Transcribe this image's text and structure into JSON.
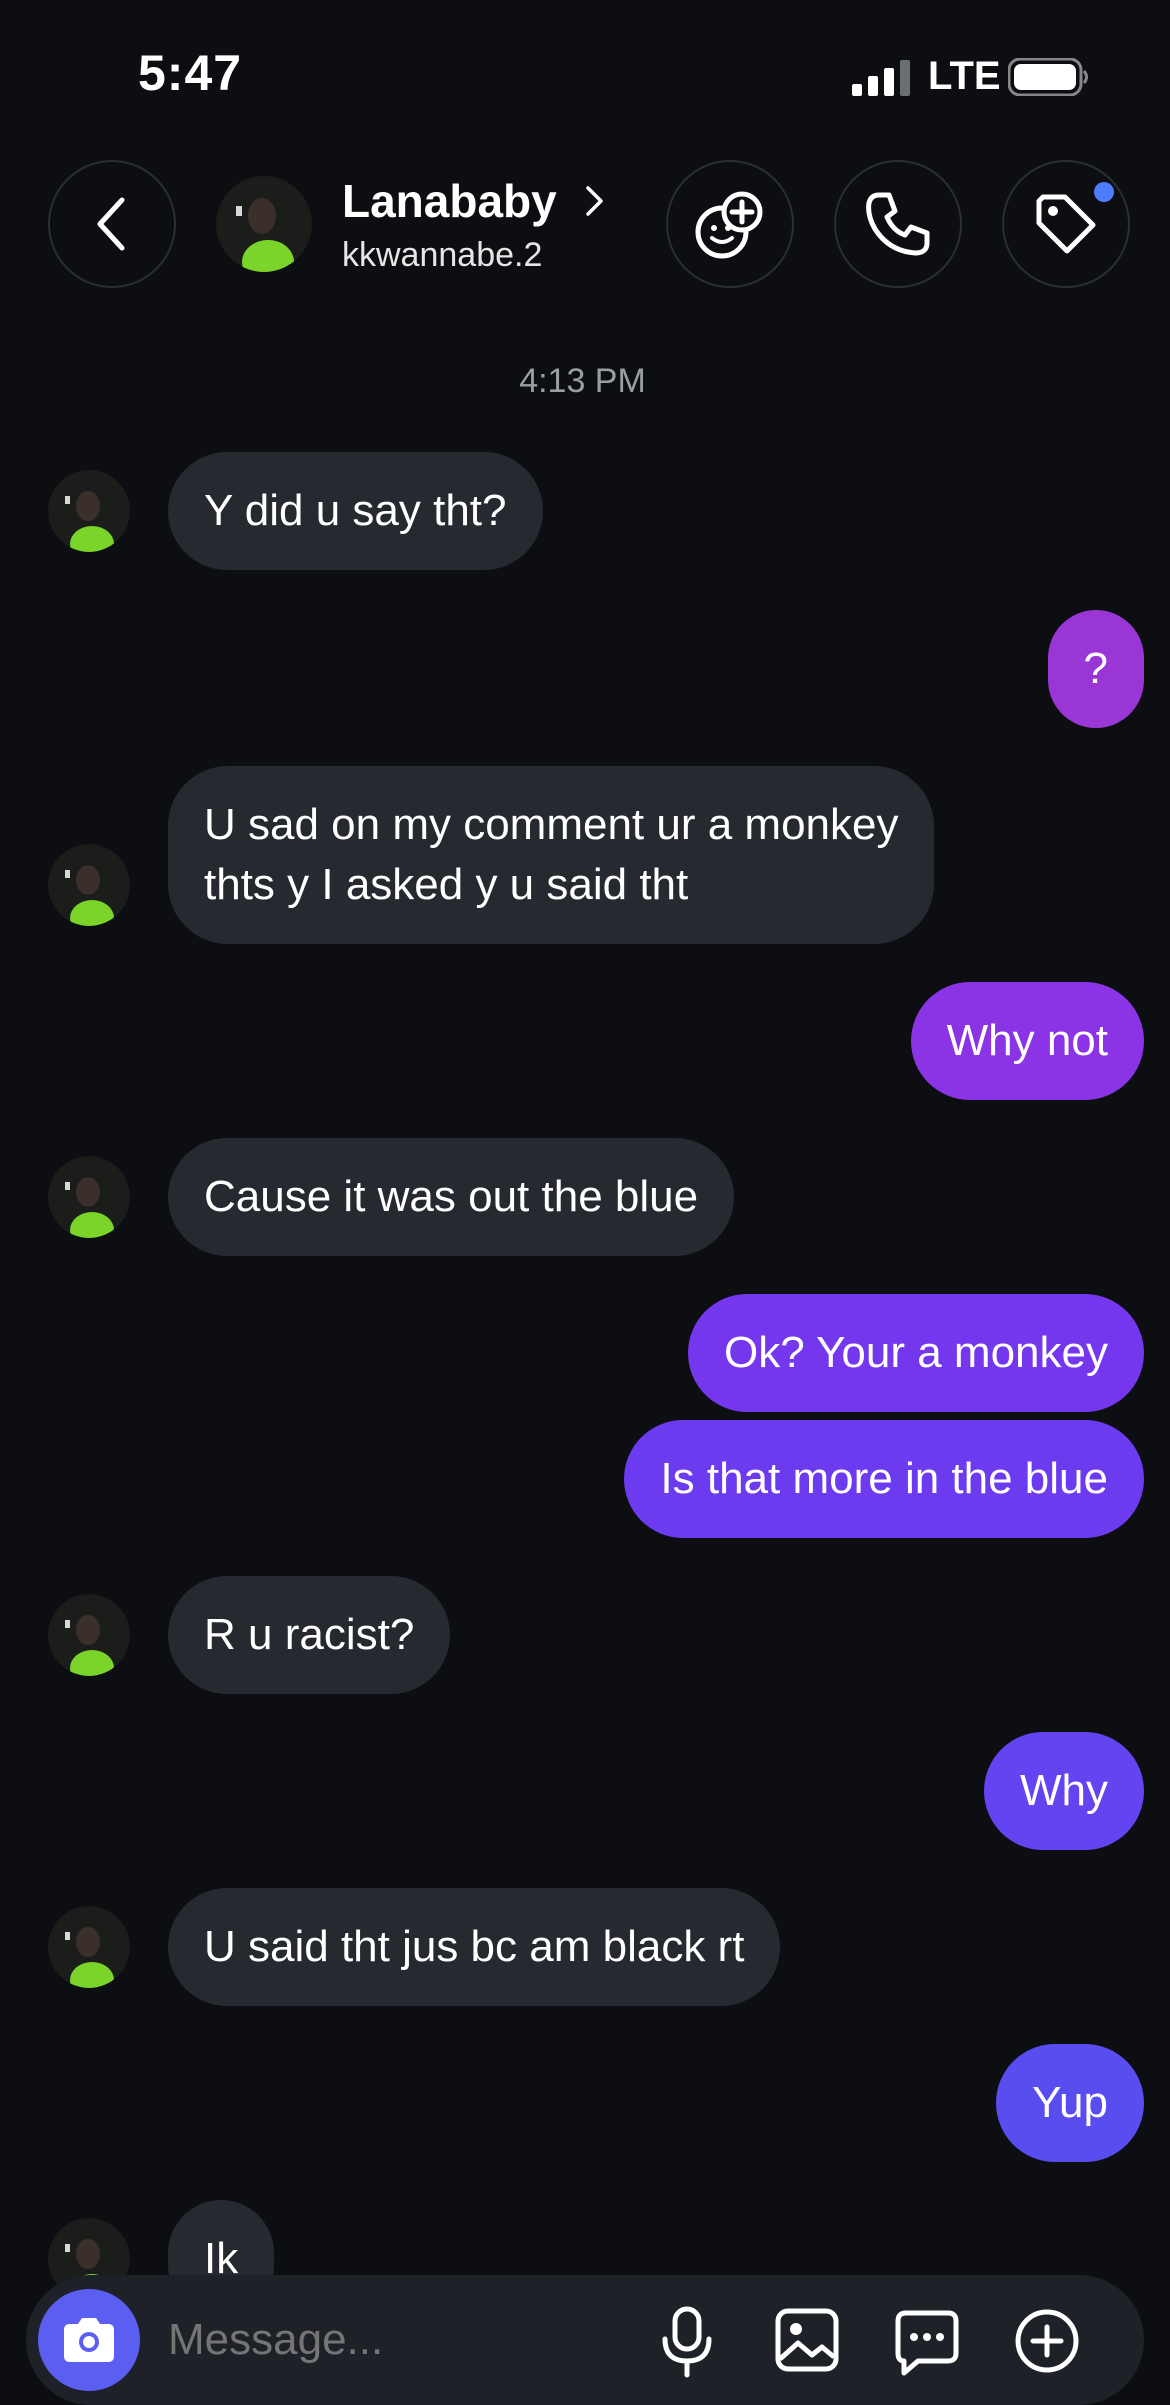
{
  "status_bar": {
    "time": "5:47",
    "network": "LTE"
  },
  "header": {
    "contact_name": "Lanababy",
    "username": "kkwannabe.2"
  },
  "conversation": {
    "timestamp": "4:13 PM",
    "messages": [
      {
        "side": "incoming",
        "lines": [
          "Y did u say tht?"
        ]
      },
      {
        "side": "outgoing",
        "lines": [
          "?"
        ],
        "color": "#9b36d6"
      },
      {
        "side": "incoming",
        "lines": [
          "U sad on my comment ur a monkey",
          "thts y I asked y u said tht"
        ]
      },
      {
        "side": "outgoing",
        "lines": [
          "Why not"
        ],
        "color": "#8a34e6"
      },
      {
        "side": "incoming",
        "lines": [
          "Cause it was out the blue"
        ]
      },
      {
        "side": "outgoing",
        "lines": [
          "Ok? Your a monkey"
        ],
        "color": "#7537ee"
      },
      {
        "side": "outgoing",
        "lines": [
          "Is that more in the blue"
        ],
        "color": "#6c3bf0"
      },
      {
        "side": "incoming",
        "lines": [
          "R u racist?"
        ]
      },
      {
        "side": "outgoing",
        "lines": [
          "Why"
        ],
        "color": "#6344f0"
      },
      {
        "side": "incoming",
        "lines": [
          "U said tht jus bc am black rt"
        ]
      },
      {
        "side": "outgoing",
        "lines": [
          "Yup"
        ],
        "color": "#5a4df0"
      },
      {
        "side": "incoming",
        "lines": [
          "Ik"
        ]
      }
    ]
  },
  "composer": {
    "placeholder": "Message..."
  },
  "colors": {
    "background": "#0c0e12",
    "incoming_bubble": "#262a30",
    "camera_button": "#5b5ef0",
    "notification_dot": "#4f7cff"
  }
}
